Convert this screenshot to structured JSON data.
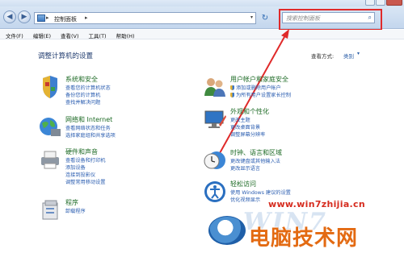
{
  "window": {
    "nav": {
      "back_icon": "back-arrow-icon",
      "forward_icon": "forward-arrow-icon"
    },
    "address": {
      "root_chevron": "▸",
      "crumb": "控制面板",
      "crumb_chevron": "▸",
      "dropdown_icon": "▾",
      "refresh_icon": "↻"
    },
    "search": {
      "placeholder": "搜索控制面板",
      "icon": "magnifier-icon"
    }
  },
  "menu": [
    "文件(F)",
    "编辑(E)",
    "查看(V)",
    "工具(T)",
    "帮助(H)"
  ],
  "main": {
    "heading": "调整计算机的设置",
    "view_by_label": "查看方式:",
    "view_by_value": "类别",
    "view_by_chevron": "▾"
  },
  "categories": [
    {
      "title": "系统和安全",
      "links": [
        "查看您的计算机状态",
        "备份您的计算机",
        "查找并解决问题"
      ]
    },
    {
      "title": "网络和 Internet",
      "links": [
        "查看网络状态和任务",
        "选择家庭组和共享选项"
      ]
    },
    {
      "title": "硬件和声音",
      "links": [
        "查看设备和打印机",
        "添加设备",
        "连接到投影仪",
        "调整常用移动设置"
      ]
    },
    {
      "title": "程序",
      "links": [
        "卸载程序"
      ]
    },
    {
      "title": "用户帐户和家庭安全",
      "links": [
        "添加或删除用户帐户",
        "为所有用户设置家长控制"
      ]
    },
    {
      "title": "外观和个性化",
      "links": [
        "更改主题",
        "更改桌面背景",
        "调整屏幕分辨率"
      ]
    },
    {
      "title": "时钟、语言和区域",
      "links": [
        "更改键盘或其他输入法",
        "更改显示语言"
      ]
    },
    {
      "title": "轻松访问",
      "links": [
        "使用 Windows 建议的设置",
        "优化视频显示"
      ]
    }
  ],
  "watermark": {
    "url": "www.win7zhijia.cn",
    "text": "电脑技术网",
    "logo": "WIN7"
  },
  "annotation": {
    "color": "#e02a2a"
  }
}
